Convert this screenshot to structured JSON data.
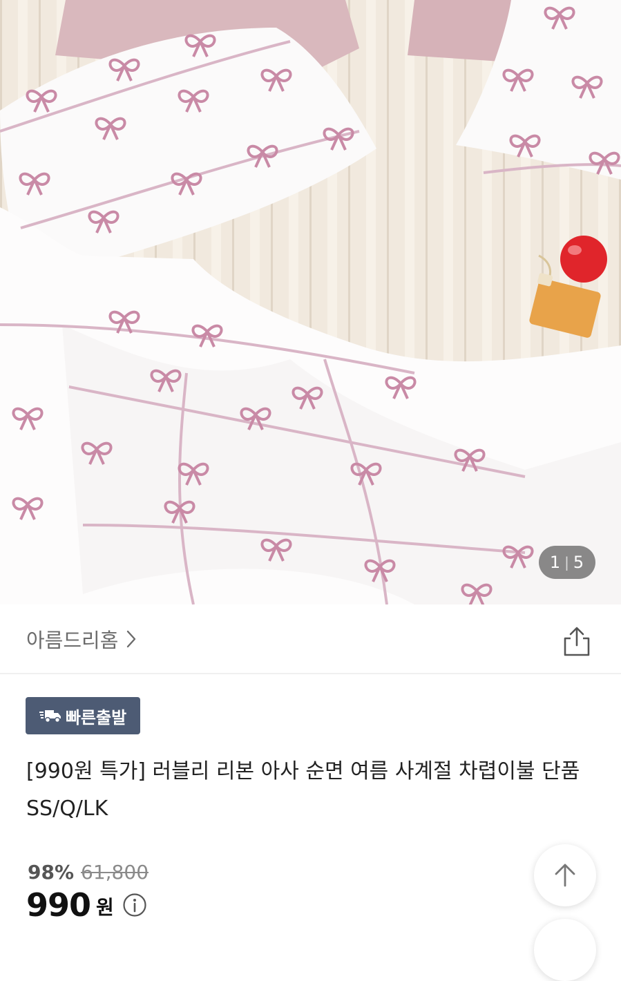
{
  "gallery": {
    "current": "1",
    "separator": "|",
    "total": "5"
  },
  "store": {
    "name": "아름드리홈",
    "chevron_icon": "chevron-right-icon",
    "share_icon": "share-icon"
  },
  "badge": {
    "icon": "truck-fast-icon",
    "label": "빠른출발"
  },
  "product": {
    "title": "[990원 특가] 러블리 리본 아사 순면 여름 사계절 차렵이불 단품 SS/Q/LK"
  },
  "price": {
    "discount_rate": "98%",
    "original": "61,800",
    "current": "990",
    "currency": "원",
    "info_icon": "info-icon"
  },
  "floating": {
    "scroll_top_icon": "arrow-up-icon"
  },
  "colors": {
    "badge_bg": "#4d5b74",
    "ribbon_pink": "#c98aa6",
    "muted_text": "#6b6b6b"
  }
}
